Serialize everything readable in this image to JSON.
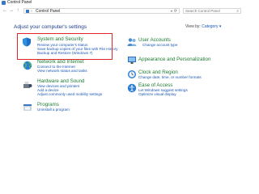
{
  "window": {
    "title": "Control Panel"
  },
  "nav": {
    "back": "←",
    "forward": "→",
    "up": "↑"
  },
  "address": {
    "separator": "›",
    "breadcrumb": "Control Panel",
    "dropdown": "▾",
    "refresh": "⟳"
  },
  "search": {
    "placeholder": "Search Control Panel",
    "icon": "⌕"
  },
  "main": {
    "heading": "Adjust your computer's settings",
    "view_by": {
      "label": "View by:",
      "value": "Category ▾"
    }
  },
  "categories": [
    {
      "title": "System and Security",
      "links": [
        "Review your computer's status",
        "Save backup copies of your files with File History",
        "Backup and Restore (Windows 7)"
      ]
    },
    {
      "title": "Network and Internet",
      "links": [
        "Connect to the Internet",
        "View network status and tasks"
      ]
    },
    {
      "title": "Hardware and Sound",
      "links": [
        "View devices and printers",
        "Add a device",
        "Adjust commonly used mobility settings"
      ]
    },
    {
      "title": "Programs",
      "links": [
        "Uninstall a program"
      ]
    },
    {
      "title": "User Accounts",
      "links": [
        "Change account type"
      ]
    },
    {
      "title": "Appearance and Personalization",
      "links": []
    },
    {
      "title": "Clock and Region",
      "links": [
        "Change date, time, or number formats"
      ]
    },
    {
      "title": "Ease of Access",
      "links": [
        "Let Windows suggest settings",
        "Optimize visual display"
      ]
    }
  ],
  "colors": {
    "title_green": "#1e7d32",
    "link_blue": "#1a56b5",
    "heading_blue": "#1e3c8c",
    "highlight_red": "#e0262a"
  }
}
